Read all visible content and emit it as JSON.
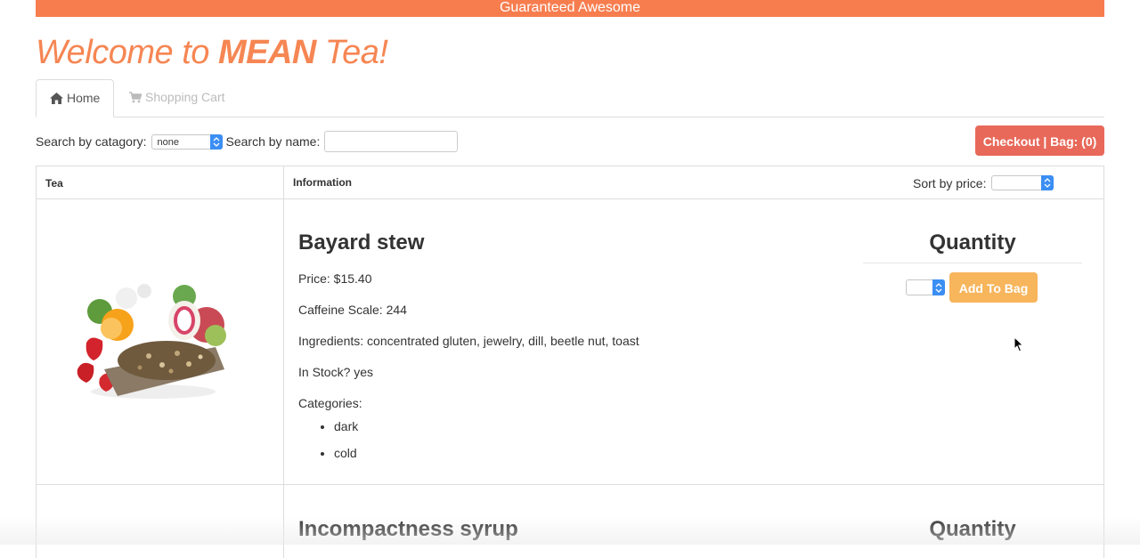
{
  "banner": {
    "text": "Guaranteed Awesome"
  },
  "heading": {
    "prefix": "Welcome to ",
    "brand": "MEAN",
    "suffix": " Tea!"
  },
  "nav": {
    "tabs": [
      {
        "label": "Home",
        "icon": "home-icon",
        "active": true
      },
      {
        "label": "Shopping Cart",
        "icon": "cart-icon",
        "active": false
      }
    ]
  },
  "search": {
    "category_label": "Search by catagory:",
    "category_value": "none",
    "name_label": "Search by name:",
    "name_value": ""
  },
  "checkout": {
    "label": "Checkout | Bag: (0)"
  },
  "table": {
    "headers": {
      "tea": "Tea",
      "information": "Information"
    },
    "sort_label": "Sort by price:",
    "sort_value": ""
  },
  "teas": [
    {
      "name": "Bayard stew",
      "price": "Price: $15.40",
      "caffeine": "Caffeine Scale: 244",
      "ingredients": "Ingredients: concentrated gluten, jewelry, dill, beetle nut, toast",
      "in_stock": "In Stock? yes",
      "categories_label": "Categories:",
      "categories": [
        "dark",
        "cold"
      ],
      "quantity_label": "Quantity",
      "quantity_value": "",
      "add_label": "Add To Bag"
    },
    {
      "name": "Incompactness syrup",
      "quantity_label": "Quantity"
    }
  ],
  "colors": {
    "accent": "#f77d4f",
    "checkout": "#e8695a",
    "add_to_bag": "#f7b55c"
  }
}
